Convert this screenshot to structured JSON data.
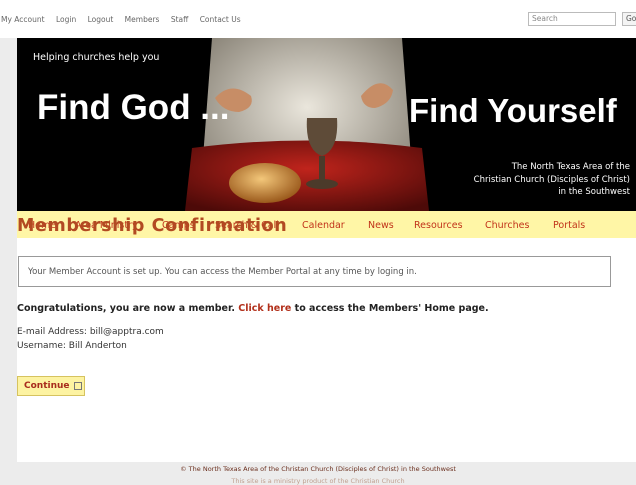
{
  "top_nav": {
    "links": [
      "My Account",
      "Login",
      "Logout",
      "Members",
      "Staff",
      "Contact Us"
    ],
    "search_placeholder": "Search",
    "search_button": "Go"
  },
  "banner": {
    "tagline": "Helping churches help you",
    "headline_left": "Find God ...",
    "headline_right": "Find Yourself",
    "credit_lines": [
      "The North Texas Area of the",
      "Christian Church (Disciples of Christ)",
      "in the Southwest"
    ]
  },
  "main_nav": [
    "Home",
    "Area Ministry",
    "Camps",
    "Search & Call",
    "Calendar",
    "News",
    "Resources",
    "Churches",
    "Portals"
  ],
  "page": {
    "title": "Membership Confirmation",
    "notice": "Your Member Account is set up. You can access the Member Portal at any time by loging in.",
    "congrats_before": "Congratulations, you are now a member.",
    "click_here": "Click here",
    "congrats_after": "to access the Members' Home page.",
    "email_line": "E-mail Address: bill@apptra.com",
    "username_line": "Username: Bill Anderton",
    "continue_label": "Continue"
  },
  "footer": {
    "copyright": "© The North Texas Area of the Christan Church (Disciples of Christ) in the Southwest",
    "second_line": "This site is a ministry product of the Christian Church"
  }
}
